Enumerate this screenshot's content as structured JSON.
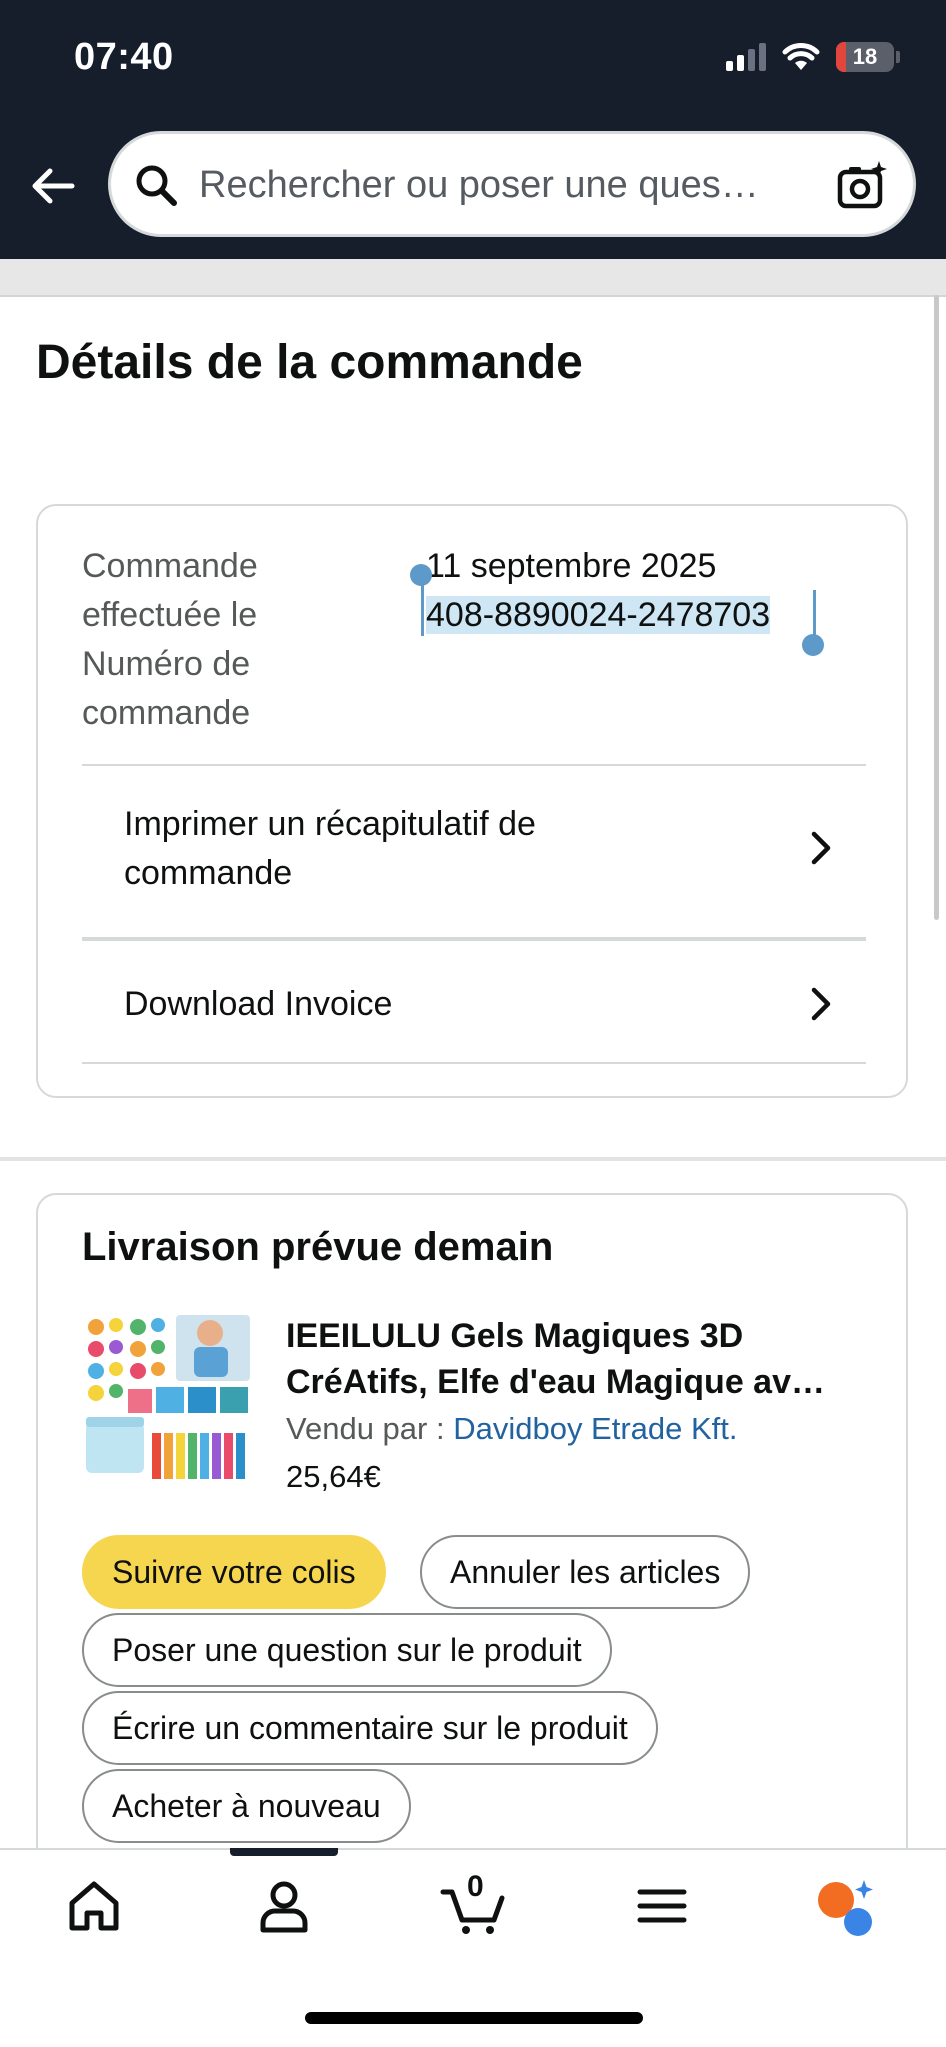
{
  "status_bar": {
    "time": "07:40",
    "battery": "18",
    "battery_level": 0.18
  },
  "search": {
    "placeholder": "Rechercher ou poser une ques…"
  },
  "page": {
    "title": "Détails de la commande"
  },
  "order": {
    "labels": [
      "Commande",
      "effectuée le",
      "Numéro de",
      "commande"
    ],
    "date": "11 septembre 2025",
    "number": "408-8890024-2478703",
    "links": [
      {
        "label_lines": [
          "Imprimer un récapitulatif de",
          "commande"
        ]
      },
      {
        "label_lines": [
          "Download Invoice"
        ]
      }
    ]
  },
  "delivery": {
    "title": "Livraison prévue demain",
    "product": {
      "title_lines": [
        "IEEILULU Gels Magiques 3D",
        "CréAtifs, Elfe d'eau Magique av…"
      ],
      "sold_by_label": "Vendu par  :",
      "seller": "Davidboy Etrade Kft.",
      "price": "25,64€"
    },
    "actions": [
      "Suivre votre colis",
      "Annuler les articles",
      "Poser une question sur le produit",
      "Écrire un commentaire sur le produit",
      "Acheter à nouveau"
    ]
  },
  "bottom_nav": {
    "cart_count": "0",
    "accent": "#f26d21",
    "assistant_accent": "#3a84e6"
  },
  "colors": {
    "header_bg": "#161d2b",
    "primary_button": "#f7d64f",
    "link": "#2162a1",
    "selection": "#cfe6f4"
  }
}
